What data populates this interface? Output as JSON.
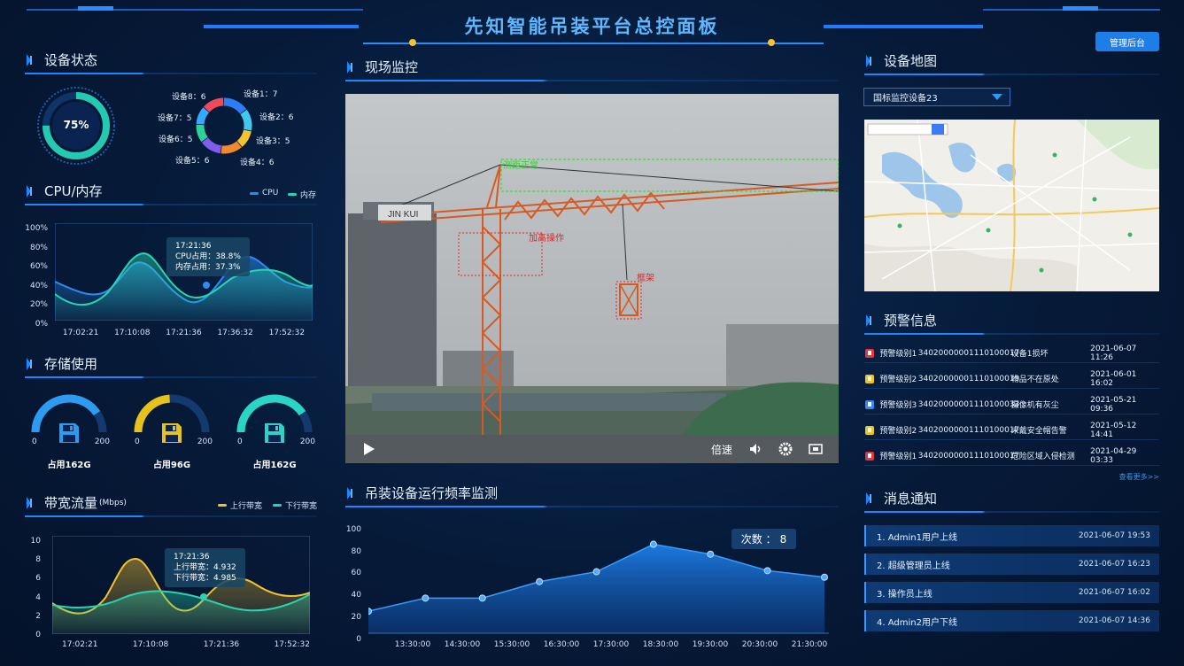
{
  "header": {
    "title": "先知智能吊装平台总控面板",
    "admin_button": "管理后台"
  },
  "device_status": {
    "title": "设备状态",
    "percent": "75%",
    "percent_value": 0.75,
    "devices": [
      {
        "label": "设备1：",
        "value": "7"
      },
      {
        "label": "设备2：",
        "value": "6"
      },
      {
        "label": "设备3：",
        "value": "5"
      },
      {
        "label": "设备4：",
        "value": "6"
      },
      {
        "label": "设备5：",
        "value": "6"
      },
      {
        "label": "设备6：",
        "value": "5"
      },
      {
        "label": "设备7：",
        "value": "5"
      },
      {
        "label": "设备8：",
        "value": "6"
      }
    ],
    "colors": [
      "#2d7df6",
      "#3fc9f0",
      "#f5c330",
      "#f08a2c",
      "#7e5df0",
      "#2bd39a",
      "#36a8ff",
      "#f04a5a"
    ]
  },
  "cpu": {
    "title": "CPU/内存",
    "legend": [
      {
        "name": "CPU",
        "color": "#2d8cf0"
      },
      {
        "name": "内存",
        "color": "#2ad4b0"
      }
    ],
    "yticks": [
      "100%",
      "80%",
      "60%",
      "40%",
      "20%",
      "0%"
    ],
    "xticks": [
      "17:02:21",
      "17:10:08",
      "17:21:36",
      "17:36:32",
      "17:52:32"
    ],
    "tooltip": {
      "time": "17:21:36",
      "l1": "CPU占用：",
      "v1": "38.8%",
      "l2": "内存占用：",
      "v2": "37.3%"
    }
  },
  "storage": {
    "title": "存储使用",
    "items": [
      {
        "min": "0",
        "max": "200",
        "caption": "占用162G",
        "used": 162,
        "color": "#2d9bf0"
      },
      {
        "min": "0",
        "max": "200",
        "caption": "占用96G",
        "used": 96,
        "color": "#e6c21d"
      },
      {
        "min": "0",
        "max": "200",
        "caption": "占用162G",
        "used": 162,
        "color": "#2ad4c6"
      }
    ]
  },
  "bandwidth": {
    "title": "带宽流量",
    "unit": "(Mbps)",
    "legend": [
      {
        "name": "上行带宽",
        "color": "#f2c12e"
      },
      {
        "name": "下行带宽",
        "color": "#2ad4b0"
      }
    ],
    "yticks": [
      "10",
      "8",
      "6",
      "4",
      "2",
      "0"
    ],
    "xticks": [
      "17:02:21",
      "17:10:08",
      "17:21:36",
      "17:52:32"
    ],
    "tooltip": {
      "time": "17:21:36",
      "l1": "上行带宽：",
      "v1": "4.932",
      "l2": "下行带宽：",
      "v2": "4.985"
    }
  },
  "monitor": {
    "title": "现场监控",
    "labels": {
      "top": "测距正常",
      "mid": "加高操作",
      "frame": "框架",
      "brand": "JIN KUI"
    },
    "controls": {
      "speed": "倍速"
    }
  },
  "freq": {
    "title": "吊装设备运行频率监测",
    "badge_label": "次数 ：",
    "badge_value": "8",
    "yticks": [
      "100",
      "80",
      "60",
      "40",
      "20",
      "0"
    ]
  },
  "chart_data": {
    "type": "area",
    "title": "吊装设备运行频率监测",
    "x": [
      "13:30:00",
      "14:30:00",
      "15:30:00",
      "16:30:00",
      "17:30:00",
      "18:30:00",
      "19:30:00",
      "20:30:00",
      "21:30:00"
    ],
    "values": [
      20,
      32,
      32,
      47,
      56,
      81,
      72,
      57,
      51
    ],
    "ylim": [
      0,
      100
    ],
    "grid": false
  },
  "map_panel": {
    "title": "设备地图",
    "select_value": "国标监控设备23"
  },
  "alerts": {
    "title": "预警信息",
    "more": "查看更多>>",
    "rows": [
      {
        "level": "预警级别1",
        "id": "34020000001110100017",
        "msg": "设备1损坏",
        "time": "2021-06-07 11:26",
        "color": "#e8353b"
      },
      {
        "level": "预警级别2",
        "id": "34020000001110100019",
        "msg": "物品不在原处",
        "time": "2021-06-01 16:02",
        "color": "#f0c419"
      },
      {
        "level": "预警级别3",
        "id": "34020000001110100033",
        "msg": "摄像机有灰尘",
        "time": "2021-05-21 09:36",
        "color": "#2d8cf0"
      },
      {
        "level": "预警级别2",
        "id": "34020000001110100017",
        "msg": "未戴安全帽告警",
        "time": "2021-05-12 14:41",
        "color": "#f0c419"
      },
      {
        "level": "预警级别1",
        "id": "34020000001110100017",
        "msg": "危险区域入侵检测",
        "time": "2021-04-29 03:33",
        "color": "#e8353b"
      }
    ]
  },
  "messages": {
    "title": "消息通知",
    "rows": [
      {
        "text": "1. Admin1用户上线",
        "time": "2021-06-07 19:53"
      },
      {
        "text": "2. 超级管理员上线",
        "time": "2021-06-07 16:23"
      },
      {
        "text": "3. 操作员上线",
        "time": "2021-06-07 16:02"
      },
      {
        "text": "4. Admin2用户下线",
        "time": "2021-06-07 14:36"
      }
    ]
  }
}
